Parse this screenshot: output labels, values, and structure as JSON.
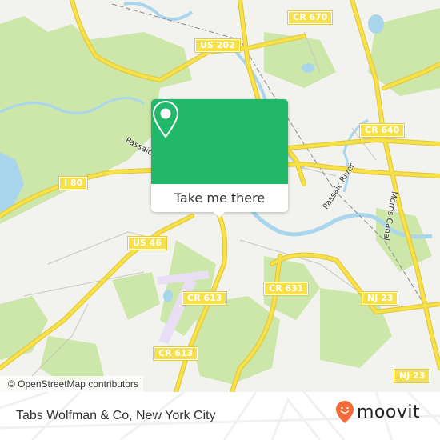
{
  "map": {
    "road_labels": [
      {
        "id": "cr670",
        "text": "CR 670"
      },
      {
        "id": "us202",
        "text": "US 202"
      },
      {
        "id": "cr640",
        "text": "CR 640"
      },
      {
        "id": "i80",
        "text": "I 80"
      },
      {
        "id": "us46",
        "text": "US 46"
      },
      {
        "id": "cr631",
        "text": "CR 631"
      },
      {
        "id": "cr613a",
        "text": "CR 613"
      },
      {
        "id": "cr613b",
        "text": "CR 613"
      },
      {
        "id": "nj23a",
        "text": "NJ 23"
      },
      {
        "id": "nj23b",
        "text": "NJ 23"
      }
    ],
    "water_labels": {
      "passaic_river": "Passaic River",
      "passaic_short": "Passaic",
      "morris_canal": "Morris Canal"
    },
    "colors": {
      "land": "#f2f2ee",
      "park": "#cde6a9",
      "water": "#a9d6ec",
      "road": "#f6e14b",
      "airport": "#e8dff5"
    }
  },
  "popup": {
    "button_label": "Take me there",
    "icon": "map-pin-icon",
    "color": "#21b86a"
  },
  "attribution": "© OpenStreetMap contributors",
  "footer": {
    "place_name": "Tabs Wolfman & Co, New York City",
    "brand": "moovit",
    "brand_color": "#f26b3a"
  }
}
